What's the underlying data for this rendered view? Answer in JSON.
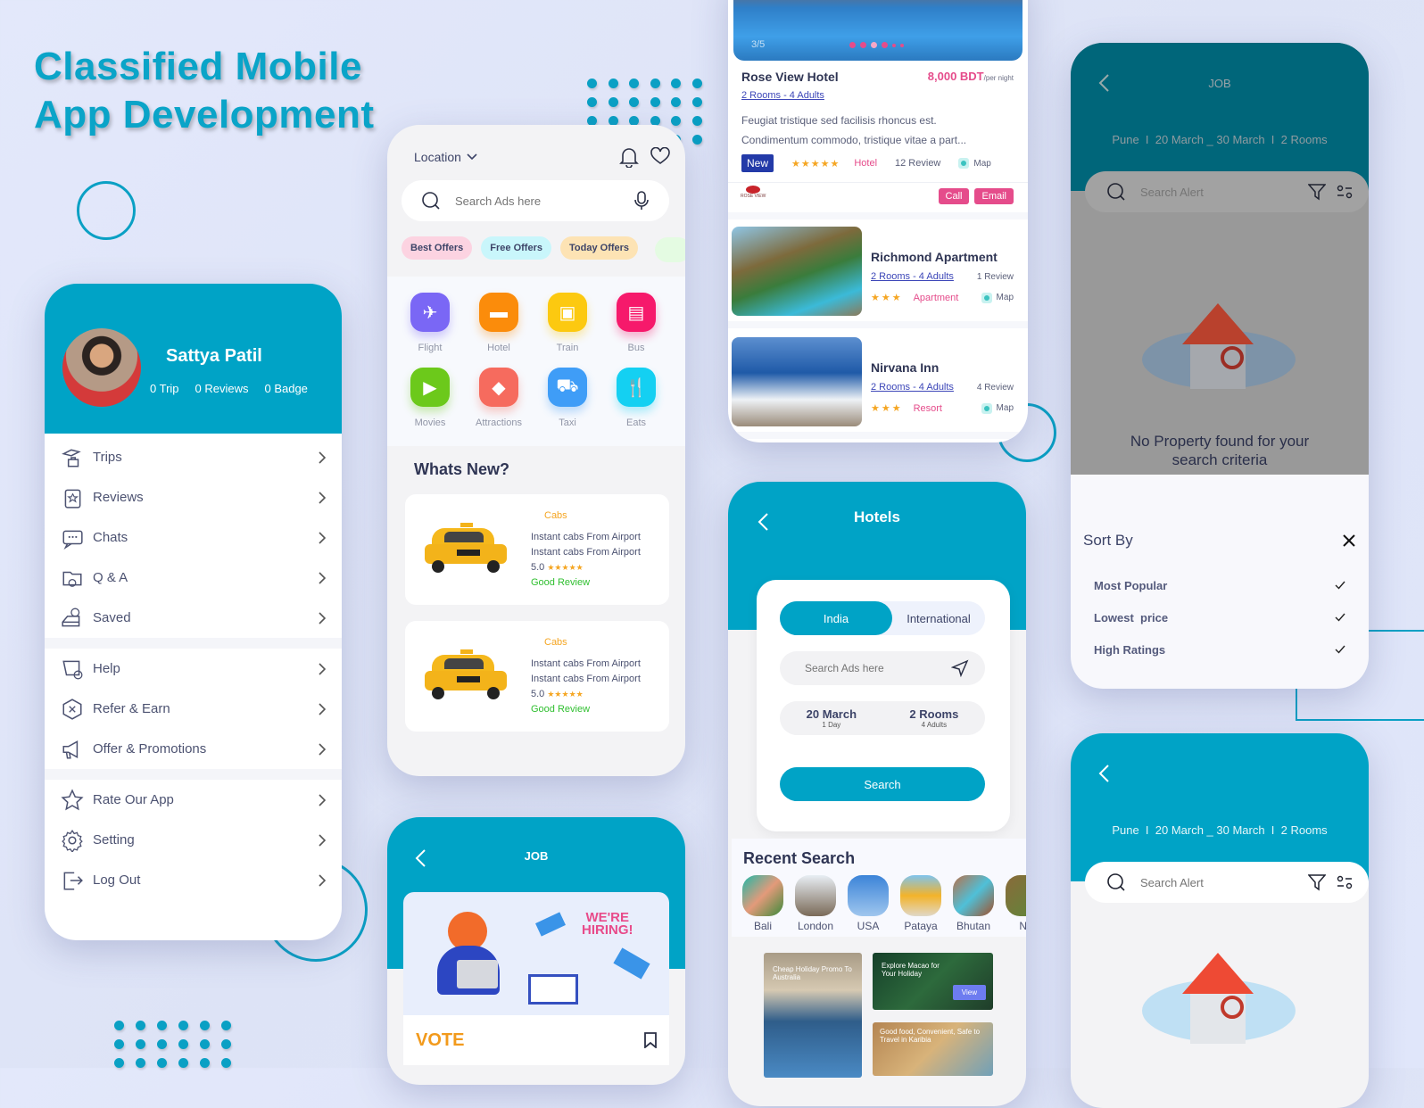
{
  "headline": {
    "line1": "Classified Mobile",
    "line2": "App Development"
  },
  "colors": {
    "brand_teal": "#00a3c6",
    "accent_pink": "#e54c8b",
    "star_gold": "#f5a623",
    "good_green": "#2fbf2f",
    "navy_badge": "#233aa8"
  },
  "profile": {
    "name": "Sattya Patil",
    "stats": [
      "0 Trip",
      "0 Reviews",
      "0 Badge"
    ],
    "menu_groups": [
      [
        {
          "label": "Trips",
          "icon": "trips-icon"
        },
        {
          "label": "Reviews",
          "icon": "reviews-icon"
        },
        {
          "label": "Chats",
          "icon": "chats-icon"
        },
        {
          "label": "Q & A",
          "icon": "qa-icon"
        },
        {
          "label": "Saved",
          "icon": "saved-icon"
        }
      ],
      [
        {
          "label": "Help",
          "icon": "help-icon"
        },
        {
          "label": "Refer & Earn",
          "icon": "refer-icon"
        },
        {
          "label": "Offer & Promotions",
          "icon": "megaphone-icon"
        }
      ],
      [
        {
          "label": "Rate Our App",
          "icon": "star-icon"
        },
        {
          "label": "Setting",
          "icon": "gear-icon"
        },
        {
          "label": "Log Out",
          "icon": "logout-icon"
        }
      ]
    ]
  },
  "home": {
    "location_label": "Location",
    "search_placeholder": "Search Ads here",
    "chips": [
      {
        "label": "Best Offers",
        "color": "#fcd3e1"
      },
      {
        "label": "Free Offers",
        "color": "#c9f6fb"
      },
      {
        "label": "Today Offers",
        "color": "#fde3b4"
      }
    ],
    "categories": [
      {
        "label": "Flight",
        "color": "#7a67f5",
        "glyph": "✈"
      },
      {
        "label": "Hotel",
        "color": "#fb8c0b",
        "glyph": "▬"
      },
      {
        "label": "Train",
        "color": "#fcc910",
        "glyph": "▣"
      },
      {
        "label": "Bus",
        "color": "#f6196b",
        "glyph": "▤"
      },
      {
        "label": "Movies",
        "color": "#6cc91b",
        "glyph": "▶"
      },
      {
        "label": "Attractions",
        "color": "#f66b5e",
        "glyph": "◆"
      },
      {
        "label": "Taxi",
        "color": "#3f9df7",
        "glyph": "⛟"
      },
      {
        "label": "Eats",
        "color": "#14d0f2",
        "glyph": "🍴"
      }
    ],
    "whats_new_title": "Whats New?",
    "offers": [
      {
        "category": "Cabs",
        "line1": "Instant cabs  From Airport",
        "line2": "Instant cabs  From Airport",
        "rating": "5.0",
        "stars": "★★★★★",
        "review": "Good Review"
      },
      {
        "category": "Cabs",
        "line1": "Instant cabs  From Airport",
        "line2": "Instant cabs  From Airport",
        "rating": "5.0",
        "stars": "★★★★★",
        "review": "Good Review"
      }
    ]
  },
  "job_screen": {
    "title": "JOB",
    "banner_text1": "WE'RE",
    "banner_text2": "HIRING!",
    "logo": "VOTE"
  },
  "hotel_list": {
    "gallery_counter": "3/5",
    "featured": {
      "name": "Rose View Hotel",
      "price": "8,000 BDT",
      "price_unit": "/per night",
      "rooms": "2 Rooms - 4 Adults",
      "description1": "Feugiat tristique sed facilisis rhoncus est.",
      "description2": "Condimentum commodo, tristique vitae a part...",
      "badge": "New",
      "stars": "★★★★★",
      "type": "Hotel",
      "reviews": "12 Review",
      "map_label": "Map",
      "logo_text": "ROSE VIEW",
      "call_label": "Call",
      "email_label": "Email"
    },
    "items": [
      {
        "name": "Richmond Apartment",
        "rooms": "2 Rooms - 4 Adults",
        "reviews": "1 Review",
        "stars": "★★★",
        "type": "Apartment",
        "map_label": "Map"
      },
      {
        "name": "Nirvana Inn",
        "rooms": "2 Rooms - 4 Adults",
        "reviews": "4 Review",
        "stars": "★★★",
        "type": "Resort",
        "map_label": "Map"
      }
    ]
  },
  "hotels_search": {
    "title": "Hotels",
    "tabs": [
      "India",
      "International"
    ],
    "active_tab": "India",
    "search_placeholder": "Search Ads here",
    "date": "20 March",
    "date_sub": "1 Day",
    "rooms": "2 Rooms",
    "rooms_sub": "4 Adults",
    "search_button": "Search",
    "recent_title": "Recent Search",
    "recent": [
      "Bali",
      "London",
      "USA",
      "Pataya",
      "Bhutan",
      "Ne"
    ],
    "promos": [
      {
        "text": "Cheap Holiday Promo To Australia"
      },
      {
        "text": "Explore Macao for Your Holiday",
        "button": "View"
      },
      {
        "text": "Good food, Convenient, Safe to Travel in Karibia"
      }
    ]
  },
  "sort_screen": {
    "title": "JOB",
    "summary": "Pune  I  20 March _ 30 March  I  2 Rooms",
    "search_placeholder": "Search Alert",
    "empty_message": "No Property found for your search criteria",
    "sort_title": "Sort By",
    "sort_options": [
      "Most Popular",
      "Lowest  price",
      "High Ratings"
    ]
  },
  "alert_screen": {
    "summary": "Pune  I  20 March _ 30 March  I  2 Rooms",
    "search_placeholder": "Search Alert"
  }
}
